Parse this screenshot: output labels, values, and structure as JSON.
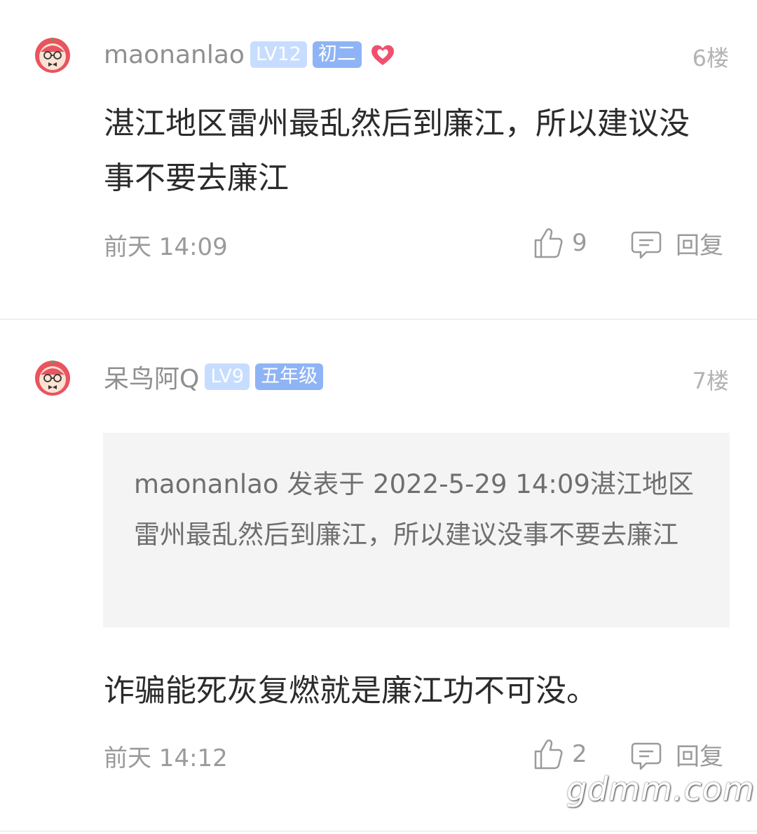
{
  "posts": [
    {
      "username": "maonanlao",
      "level": "LV12",
      "grade": "初二",
      "floor": "6楼",
      "content": "湛江地区雷州最乱然后到廉江，所以建议没事不要去廉江",
      "time": "前天 14:09",
      "likes": "9",
      "reply_label": "回复"
    },
    {
      "username": "呆鸟阿Q",
      "level": "LV9",
      "grade": "五年级",
      "floor": "7楼",
      "quote": "maonanlao 发表于 2022-5-29 14:09湛江地区雷州最乱然后到廉江，所以建议没事不要去廉江",
      "content": "诈骗能死灰复燃就是廉江功不可没。",
      "time": "前天 14:12",
      "likes": "2",
      "reply_label": "回复"
    }
  ],
  "watermark": "gdmm.com",
  "icons": {
    "avatar": "lychee-mascot-avatar",
    "heart": "heart-icon",
    "like": "thumbs-up-icon",
    "reply": "comment-icon"
  },
  "colors": {
    "badge_level": "#c7ddff",
    "badge_grade": "#8fb4f5",
    "heart": "#f0506e",
    "quote_bg": "#f4f4f4"
  }
}
